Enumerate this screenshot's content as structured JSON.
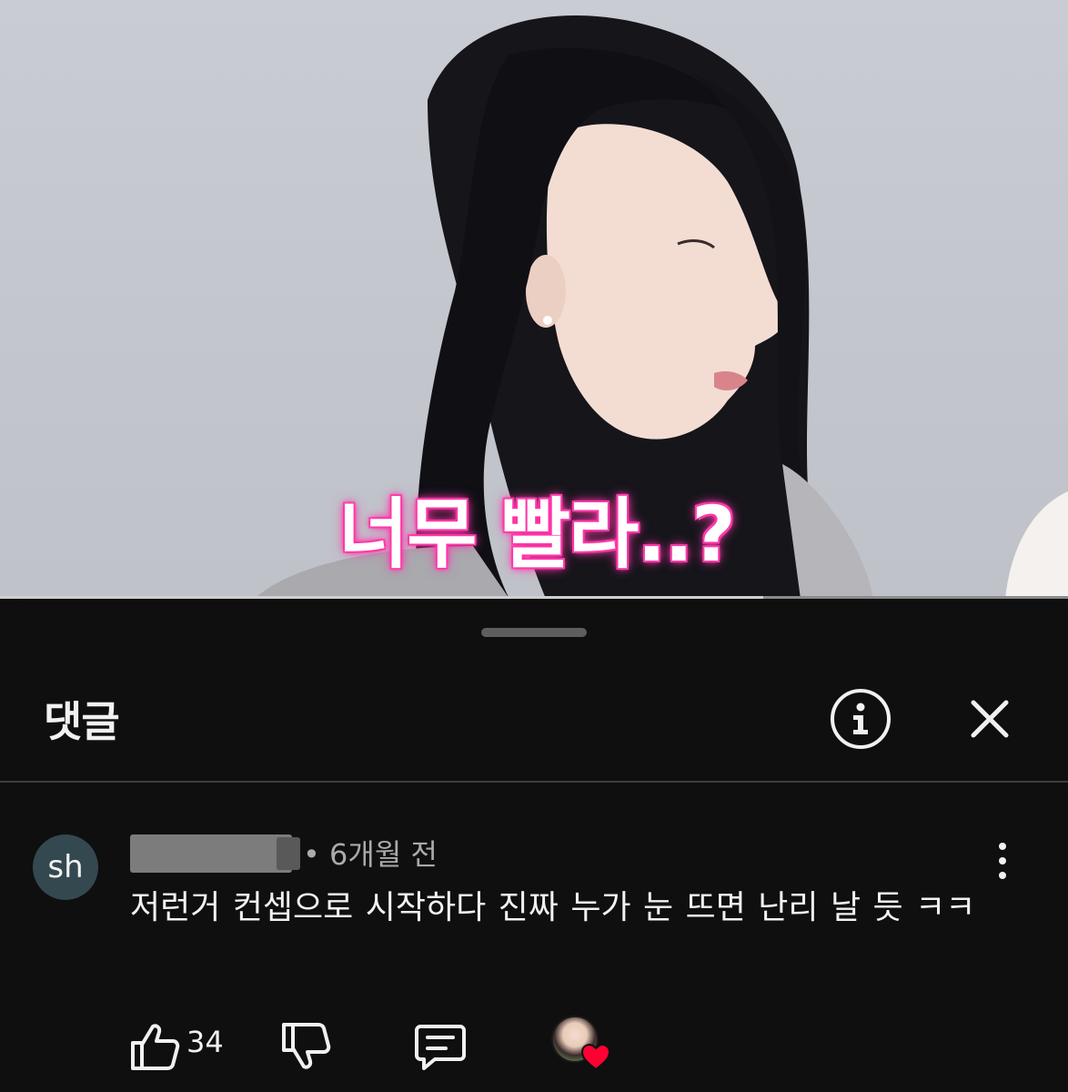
{
  "video": {
    "caption": "너무 빨라..?",
    "progress": 0.715
  },
  "sheet": {
    "title": "댓글"
  },
  "comment": {
    "avatar_initials": "sh",
    "meta": "• 6개월 전",
    "text": "저런거 컨셉으로 시작하다 진짜 누가 눈 뜨면 난리 날 듯 ㅋㅋ",
    "like_count": "34"
  },
  "colors": {
    "background": "#0f0f0f",
    "text_primary": "#f1f1f1",
    "text_secondary": "#aaaaaa",
    "heart": "#ff0033",
    "caption_glow": "#ff2fa3"
  },
  "icons": [
    "info-icon",
    "close-icon",
    "more-vert-icon",
    "like-icon",
    "dislike-icon",
    "reply-icon",
    "heart-icon"
  ]
}
